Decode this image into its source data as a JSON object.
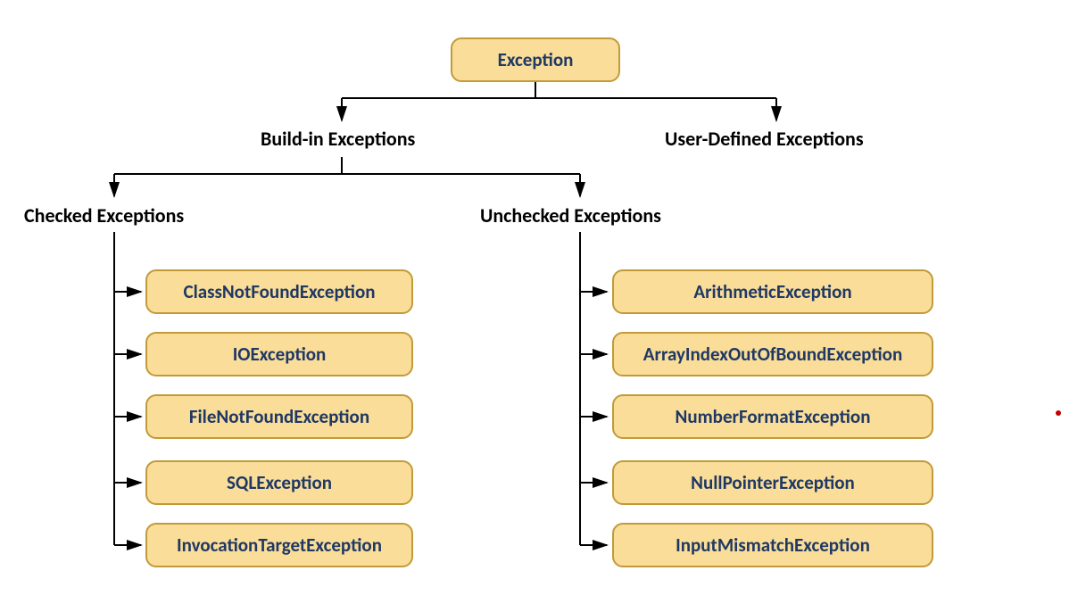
{
  "root": {
    "label": "Exception"
  },
  "level1": {
    "builtin": "Build-in Exceptions",
    "userdefined": "User-Defined Exceptions"
  },
  "level2": {
    "checked": "Checked Exceptions",
    "unchecked": "Unchecked Exceptions"
  },
  "checkedItems": [
    "ClassNotFoundException",
    "IOException",
    "FileNotFoundException",
    "SQLException",
    "InvocationTargetException"
  ],
  "uncheckedItems": [
    "ArithmeticException",
    "ArrayIndexOutOfBoundException",
    "NumberFormatException",
    "NullPointerException",
    "InputMismatchException"
  ]
}
